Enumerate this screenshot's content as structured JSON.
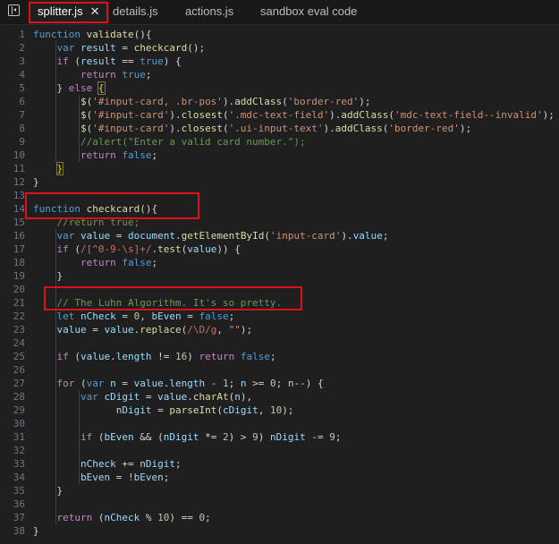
{
  "tabs": [
    {
      "label": "splitter.js",
      "active": true,
      "close": "✕"
    },
    {
      "label": "details.js",
      "active": false
    },
    {
      "label": "actions.js",
      "active": false
    },
    {
      "label": "sandbox eval code",
      "active": false
    }
  ],
  "code_lines": [
    {
      "n": "1",
      "t": [
        [
          "kw",
          "function"
        ],
        [
          "pl",
          " "
        ],
        [
          "fn",
          "validate"
        ],
        [
          "pl",
          "(){"
        ]
      ]
    },
    {
      "n": "2",
      "t": [
        [
          "pl",
          "    "
        ],
        [
          "kw",
          "var"
        ],
        [
          "pl",
          " "
        ],
        [
          "var",
          "result"
        ],
        [
          "pl",
          " = "
        ],
        [
          "fn",
          "checkcard"
        ],
        [
          "pl",
          "();"
        ]
      ]
    },
    {
      "n": "3",
      "t": [
        [
          "pl",
          "    "
        ],
        [
          "ctl",
          "if"
        ],
        [
          "pl",
          " ("
        ],
        [
          "var",
          "result"
        ],
        [
          "pl",
          " == "
        ],
        [
          "kw",
          "true"
        ],
        [
          "pl",
          ") {"
        ]
      ]
    },
    {
      "n": "4",
      "t": [
        [
          "pl",
          "        "
        ],
        [
          "ctl",
          "return"
        ],
        [
          "pl",
          " "
        ],
        [
          "kw",
          "true"
        ],
        [
          "pl",
          ";"
        ]
      ]
    },
    {
      "n": "5",
      "t": [
        [
          "pl",
          "    } "
        ],
        [
          "ctl",
          "else"
        ],
        [
          "pl",
          " "
        ],
        [
          "brm",
          "{"
        ]
      ]
    },
    {
      "n": "6",
      "t": [
        [
          "pl",
          "        "
        ],
        [
          "fn",
          "$"
        ],
        [
          "pl",
          "("
        ],
        [
          "str",
          "'#input-card, .br-pos'"
        ],
        [
          "pl",
          ")."
        ],
        [
          "fn",
          "addClass"
        ],
        [
          "pl",
          "("
        ],
        [
          "str",
          "'border-red'"
        ],
        [
          "pl",
          ");"
        ]
      ]
    },
    {
      "n": "7",
      "t": [
        [
          "pl",
          "        "
        ],
        [
          "fn",
          "$"
        ],
        [
          "pl",
          "("
        ],
        [
          "str",
          "'#input-card'"
        ],
        [
          "pl",
          ")."
        ],
        [
          "fn",
          "closest"
        ],
        [
          "pl",
          "("
        ],
        [
          "str",
          "'.mdc-text-field'"
        ],
        [
          "pl",
          ")."
        ],
        [
          "fn",
          "addClass"
        ],
        [
          "pl",
          "("
        ],
        [
          "str",
          "'mdc-text-field--invalid'"
        ],
        [
          "pl",
          ");"
        ]
      ]
    },
    {
      "n": "8",
      "t": [
        [
          "pl",
          "        "
        ],
        [
          "fn",
          "$"
        ],
        [
          "pl",
          "("
        ],
        [
          "str",
          "'#input-card'"
        ],
        [
          "pl",
          ")."
        ],
        [
          "fn",
          "closest"
        ],
        [
          "pl",
          "("
        ],
        [
          "str",
          "'.ui-input-text'"
        ],
        [
          "pl",
          ")."
        ],
        [
          "fn",
          "addClass"
        ],
        [
          "pl",
          "("
        ],
        [
          "str",
          "'border-red'"
        ],
        [
          "pl",
          ");"
        ]
      ]
    },
    {
      "n": "9",
      "t": [
        [
          "pl",
          "        "
        ],
        [
          "cmt",
          "//alert(\"Enter a valid card number.\");"
        ]
      ]
    },
    {
      "n": "10",
      "t": [
        [
          "pl",
          "        "
        ],
        [
          "ctl",
          "return"
        ],
        [
          "pl",
          " "
        ],
        [
          "kw",
          "false"
        ],
        [
          "pl",
          ";"
        ]
      ]
    },
    {
      "n": "11",
      "t": [
        [
          "pl",
          "    "
        ],
        [
          "brm",
          "}"
        ]
      ]
    },
    {
      "n": "12",
      "t": [
        [
          "pl",
          "}"
        ]
      ]
    },
    {
      "n": "13",
      "t": []
    },
    {
      "n": "14",
      "t": [
        [
          "kw",
          "function"
        ],
        [
          "pl",
          " "
        ],
        [
          "fn",
          "checkcard"
        ],
        [
          "pl",
          "(){"
        ]
      ]
    },
    {
      "n": "15",
      "t": [
        [
          "pl",
          "    "
        ],
        [
          "cmt",
          "//return true;"
        ]
      ]
    },
    {
      "n": "16",
      "t": [
        [
          "pl",
          "    "
        ],
        [
          "kw",
          "var"
        ],
        [
          "pl",
          " "
        ],
        [
          "var",
          "value"
        ],
        [
          "pl",
          " = "
        ],
        [
          "var",
          "document"
        ],
        [
          "pl",
          "."
        ],
        [
          "fn",
          "getElementById"
        ],
        [
          "pl",
          "("
        ],
        [
          "str",
          "'input-card'"
        ],
        [
          "pl",
          ")."
        ],
        [
          "var",
          "value"
        ],
        [
          "pl",
          ";"
        ]
      ]
    },
    {
      "n": "17",
      "t": [
        [
          "pl",
          "    "
        ],
        [
          "ctl",
          "if"
        ],
        [
          "pl",
          " ("
        ],
        [
          "rx",
          "/[^0-9-\\s]+/"
        ],
        [
          "pl",
          "."
        ],
        [
          "fn",
          "test"
        ],
        [
          "pl",
          "("
        ],
        [
          "var",
          "value"
        ],
        [
          "pl",
          ")) {"
        ]
      ]
    },
    {
      "n": "18",
      "t": [
        [
          "pl",
          "        "
        ],
        [
          "ctl",
          "return"
        ],
        [
          "pl",
          " "
        ],
        [
          "kw",
          "false"
        ],
        [
          "pl",
          ";"
        ]
      ]
    },
    {
      "n": "19",
      "t": [
        [
          "pl",
          "    }"
        ]
      ]
    },
    {
      "n": "20",
      "t": []
    },
    {
      "n": "21",
      "t": [
        [
          "pl",
          "    "
        ],
        [
          "cmt",
          "// The Luhn Algorithm. It's so pretty."
        ]
      ]
    },
    {
      "n": "22",
      "t": [
        [
          "pl",
          "    "
        ],
        [
          "kw",
          "let"
        ],
        [
          "pl",
          " "
        ],
        [
          "var",
          "nCheck"
        ],
        [
          "pl",
          " = "
        ],
        [
          "num",
          "0"
        ],
        [
          "pl",
          ", "
        ],
        [
          "var",
          "bEven"
        ],
        [
          "pl",
          " = "
        ],
        [
          "kw",
          "false"
        ],
        [
          "pl",
          ";"
        ]
      ]
    },
    {
      "n": "23",
      "t": [
        [
          "pl",
          "    "
        ],
        [
          "var",
          "value"
        ],
        [
          "pl",
          " = "
        ],
        [
          "var",
          "value"
        ],
        [
          "pl",
          "."
        ],
        [
          "fn",
          "replace"
        ],
        [
          "pl",
          "("
        ],
        [
          "rx",
          "/\\D/g"
        ],
        [
          "pl",
          ", "
        ],
        [
          "str",
          "\"\""
        ],
        [
          "pl",
          ");"
        ]
      ]
    },
    {
      "n": "24",
      "t": []
    },
    {
      "n": "25",
      "t": [
        [
          "pl",
          "    "
        ],
        [
          "ctl",
          "if"
        ],
        [
          "pl",
          " ("
        ],
        [
          "var",
          "value"
        ],
        [
          "pl",
          "."
        ],
        [
          "var",
          "length"
        ],
        [
          "pl",
          " != "
        ],
        [
          "num",
          "16"
        ],
        [
          "pl",
          ") "
        ],
        [
          "ctl",
          "return"
        ],
        [
          "pl",
          " "
        ],
        [
          "kw",
          "false"
        ],
        [
          "pl",
          ";"
        ]
      ]
    },
    {
      "n": "26",
      "t": []
    },
    {
      "n": "27",
      "t": [
        [
          "pl",
          "    "
        ],
        [
          "ctl",
          "for"
        ],
        [
          "pl",
          " ("
        ],
        [
          "kw",
          "var"
        ],
        [
          "pl",
          " "
        ],
        [
          "var",
          "n"
        ],
        [
          "pl",
          " = "
        ],
        [
          "var",
          "value"
        ],
        [
          "pl",
          "."
        ],
        [
          "var",
          "length"
        ],
        [
          "pl",
          " - "
        ],
        [
          "num",
          "1"
        ],
        [
          "pl",
          "; "
        ],
        [
          "var",
          "n"
        ],
        [
          "pl",
          " >= "
        ],
        [
          "num",
          "0"
        ],
        [
          "pl",
          "; "
        ],
        [
          "var",
          "n"
        ],
        [
          "pl",
          "--) {"
        ]
      ]
    },
    {
      "n": "28",
      "t": [
        [
          "pl",
          "        "
        ],
        [
          "kw",
          "var"
        ],
        [
          "pl",
          " "
        ],
        [
          "var",
          "cDigit"
        ],
        [
          "pl",
          " = "
        ],
        [
          "var",
          "value"
        ],
        [
          "pl",
          "."
        ],
        [
          "fn",
          "charAt"
        ],
        [
          "pl",
          "("
        ],
        [
          "var",
          "n"
        ],
        [
          "pl",
          "),"
        ]
      ]
    },
    {
      "n": "29",
      "t": [
        [
          "pl",
          "              "
        ],
        [
          "var",
          "nDigit"
        ],
        [
          "pl",
          " = "
        ],
        [
          "fn",
          "parseInt"
        ],
        [
          "pl",
          "("
        ],
        [
          "var",
          "cDigit"
        ],
        [
          "pl",
          ", "
        ],
        [
          "num",
          "10"
        ],
        [
          "pl",
          ");"
        ]
      ]
    },
    {
      "n": "30",
      "t": []
    },
    {
      "n": "31",
      "t": [
        [
          "pl",
          "        "
        ],
        [
          "ctl",
          "if"
        ],
        [
          "pl",
          " ("
        ],
        [
          "var",
          "bEven"
        ],
        [
          "pl",
          " && ("
        ],
        [
          "var",
          "nDigit"
        ],
        [
          "pl",
          " *= "
        ],
        [
          "num",
          "2"
        ],
        [
          "pl",
          ") > "
        ],
        [
          "num",
          "9"
        ],
        [
          "pl",
          ") "
        ],
        [
          "var",
          "nDigit"
        ],
        [
          "pl",
          " -= "
        ],
        [
          "num",
          "9"
        ],
        [
          "pl",
          ";"
        ]
      ]
    },
    {
      "n": "32",
      "t": []
    },
    {
      "n": "33",
      "t": [
        [
          "pl",
          "        "
        ],
        [
          "var",
          "nCheck"
        ],
        [
          "pl",
          " += "
        ],
        [
          "var",
          "nDigit"
        ],
        [
          "pl",
          ";"
        ]
      ]
    },
    {
      "n": "34",
      "t": [
        [
          "pl",
          "        "
        ],
        [
          "var",
          "bEven"
        ],
        [
          "pl",
          " = !"
        ],
        [
          "var",
          "bEven"
        ],
        [
          "pl",
          ";"
        ]
      ]
    },
    {
      "n": "35",
      "t": [
        [
          "pl",
          "    }"
        ]
      ]
    },
    {
      "n": "36",
      "t": []
    },
    {
      "n": "37",
      "t": [
        [
          "pl",
          "    "
        ],
        [
          "ctl",
          "return"
        ],
        [
          "pl",
          " ("
        ],
        [
          "var",
          "nCheck"
        ],
        [
          "pl",
          " % "
        ],
        [
          "num",
          "10"
        ],
        [
          "pl",
          ") == "
        ],
        [
          "num",
          "0"
        ],
        [
          "pl",
          ";"
        ]
      ]
    },
    {
      "n": "38",
      "t": [
        [
          "pl",
          "}"
        ]
      ]
    }
  ],
  "colors": {
    "highlight_box": "#e0101b",
    "editor_bg": "#1f1f1f",
    "keyword": "#569cd6",
    "control": "#c586c0",
    "function": "#dcdcaa",
    "string": "#ce9178",
    "comment": "#6a9955"
  }
}
